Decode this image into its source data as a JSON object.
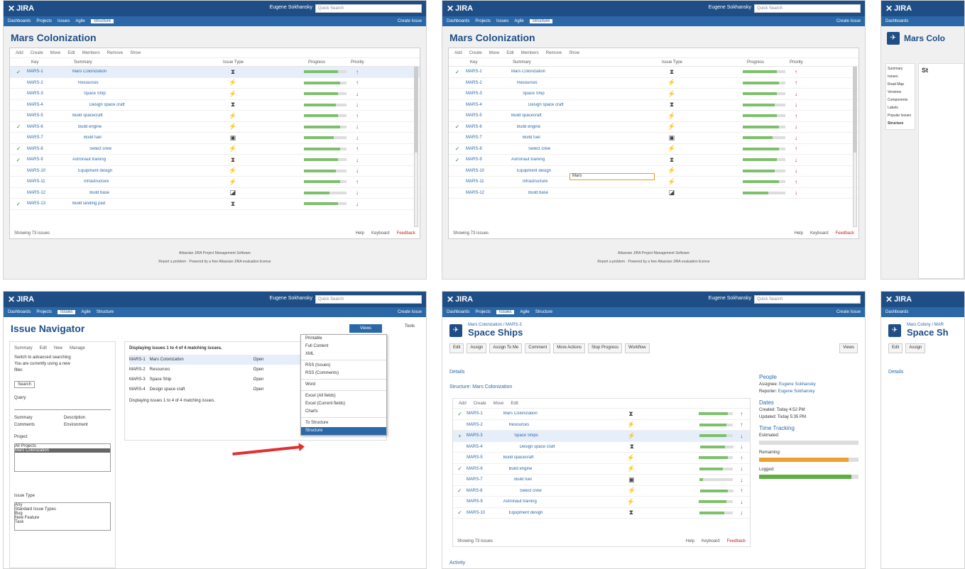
{
  "app": {
    "name": "JIRA",
    "user": "Eugene Sokhansky",
    "quick_search": "Quick Search",
    "nav_items": [
      "Dashboards",
      "Projects",
      "Issues",
      "Agile",
      "Structure"
    ],
    "nav_right": "Create Issue"
  },
  "structure_page": {
    "title": "Mars Colonization",
    "toolbar": [
      "Add",
      "Create",
      "Move",
      "Edit",
      "Members",
      "Remove",
      "Show"
    ],
    "columns": [
      "Key",
      "Summary",
      "Issue Type",
      "Progress",
      "Priority"
    ],
    "rows": [
      {
        "check": "✓",
        "key": "MARS-1",
        "summary": "Mars Colonization",
        "type": "⧗",
        "progress": 0.8,
        "prio": "↑"
      },
      {
        "check": "",
        "key": "MARS-2",
        "summary": "Resources",
        "type": "⚡",
        "progress": 0.85,
        "prio": "↑"
      },
      {
        "check": "",
        "key": "MARS-3",
        "summary": "Space Ship",
        "type": "⚡",
        "progress": 0.8,
        "prio": "↓"
      },
      {
        "check": "",
        "key": "MARS-4",
        "summary": "Design space craft",
        "type": "⧗",
        "progress": 0.75,
        "prio": "↓"
      },
      {
        "check": "",
        "key": "MARS-5",
        "summary": "Build spacecraft",
        "type": "⚡",
        "progress": 0.8,
        "prio": "↑"
      },
      {
        "check": "✓",
        "key": "MARS-6",
        "summary": "Build engine",
        "type": "⚡",
        "progress": 0.85,
        "prio": "↓"
      },
      {
        "check": "",
        "key": "MARS-7",
        "summary": "Build fuel",
        "type": "▣",
        "progress": 0.7,
        "prio": "↓"
      },
      {
        "check": "✓",
        "key": "MARS-8",
        "summary": "Select crew",
        "type": "⚡",
        "progress": 0.85,
        "prio": "↑"
      },
      {
        "check": "✓",
        "key": "MARS-9",
        "summary": "Astronaut training",
        "type": "⧗",
        "progress": 0.8,
        "prio": "↓"
      },
      {
        "check": "",
        "key": "MARS-10",
        "summary": "Equipment design",
        "type": "⚡",
        "progress": 0.75,
        "prio": "↓"
      },
      {
        "check": "",
        "key": "MARS-11",
        "summary": "Infrastructure",
        "type": "⚡",
        "progress": 0.85,
        "prio": "↑"
      },
      {
        "check": "",
        "key": "MARS-12",
        "summary": "Build base",
        "type": "◪",
        "progress": 0.6,
        "prio": "↓"
      },
      {
        "check": "✓",
        "key": "MARS-13",
        "summary": "Build landing pad",
        "type": "⧗",
        "progress": 0.8,
        "prio": "↓"
      }
    ],
    "footer_left": "Showing 73 issues",
    "footer_help": "Help",
    "footer_keyboard": "Keyboard",
    "footer_feedback": "Feedback",
    "footer_line1": "Atlassian JIRA Project Management Software",
    "footer_line2": "Report a problem · Powered by a free Atlassian JIRA evaluation license",
    "editing_value": "Mars"
  },
  "right_partial": {
    "title": "Mars Colo",
    "side_items": [
      "Summary",
      "Issues",
      "Road Map",
      "Versions",
      "Components",
      "Labels",
      "Popular Issues",
      "Structure"
    ],
    "selected_item": "Structure",
    "main_heading": "St"
  },
  "issue_nav": {
    "title": "Issue Navigator",
    "views": "Views",
    "tools": "Tools",
    "tabs": [
      "Summary",
      "Edit",
      "New",
      "Manage"
    ],
    "intro": "Switch to advanced searching",
    "info1": "You are currently using a new",
    "info2": "filter.",
    "search_btn": "Search",
    "query_label": "Query",
    "checks": [
      "Summary",
      "Description",
      "Comments",
      "Environment"
    ],
    "project_label": "Project",
    "projects": [
      "All Projects",
      "Mars Colonization"
    ],
    "type_label": "Issue Type",
    "types": [
      "Any",
      "Standard Issue Types",
      "Bug",
      "New Feature",
      "Task"
    ],
    "results_header": "Displaying issues 1 to 4 of 4 matching issues.",
    "results": [
      {
        "key": "MARS-1",
        "summary": "Mars Colonization",
        "status": "Open"
      },
      {
        "key": "MARS-2",
        "summary": "Resources",
        "status": "Open"
      },
      {
        "key": "MARS-3",
        "summary": "Space Ship",
        "status": "Open"
      },
      {
        "key": "MARS-4",
        "summary": "Design space craft",
        "status": "Open"
      }
    ],
    "results_footer": "Displaying issues 1 to 4 of 4 matching issues.",
    "menu": [
      "Printable",
      "Full Content",
      "XML",
      "RSS (Issues)",
      "RSS (Comments)",
      "Word",
      "Excel (All fields)",
      "Excel (Current fields)",
      "Charts",
      "To Structure",
      "Structure"
    ],
    "menu_highlighted": "Structure"
  },
  "space_ships": {
    "crumb": "Mars Colonization / MARS-3",
    "title": "Space Ships",
    "actions": [
      "Edit",
      "Assign",
      "Assign To Me",
      "Comment",
      "More Actions",
      "Stop Progress",
      "Workflow"
    ],
    "views": "Views",
    "details": "Details",
    "structure": "Structure: Mars Colonization",
    "people": "People",
    "assignee_label": "Assignee:",
    "assignee": "Eugene Sokhansky",
    "reporter_label": "Reporter:",
    "reporter": "Eugene Sokhansky",
    "dates": "Dates",
    "created_label": "Created:",
    "created": "Today 4:52 PM",
    "updated_label": "Updated:",
    "updated": "Today 5:35 PM",
    "time": "Time Tracking",
    "estimated_label": "Estimated:",
    "remaining_label": "Remaining:",
    "logged_label": "Logged:",
    "estimated_progress": 0.0,
    "remaining_progress": 0.9,
    "logged_progress": 0.93,
    "activity": "Activity",
    "rows": [
      {
        "check": "✓",
        "key": "MARS-1",
        "summary": "Mars Colonization",
        "progress": 0.85,
        "type": "⧗",
        "prio": "↑"
      },
      {
        "check": "",
        "key": "MARS-2",
        "summary": "Resources",
        "progress": 0.8,
        "type": "⚡",
        "prio": "↑"
      },
      {
        "check": "+",
        "key": "MARS-3",
        "summary": "Space Ships",
        "progress": 0.8,
        "type": "⚡",
        "prio": "↓"
      },
      {
        "check": "",
        "key": "MARS-4",
        "summary": "Design space craft",
        "progress": 0.75,
        "type": "⧗",
        "prio": "↓"
      },
      {
        "check": "",
        "key": "MARS-5",
        "summary": "Build spacecraft",
        "progress": 0.85,
        "type": "⚡",
        "prio": "↑"
      },
      {
        "check": "✓",
        "key": "MARS-6",
        "summary": "Build engine",
        "progress": 0.7,
        "type": "⚡",
        "prio": "↓"
      },
      {
        "check": "",
        "key": "MARS-7",
        "summary": "Build fuel",
        "progress": 0.1,
        "type": "▣",
        "prio": "↓"
      },
      {
        "check": "✓",
        "key": "MARS-8",
        "summary": "Select crew",
        "progress": 0.85,
        "type": "⚡",
        "prio": "↑"
      },
      {
        "check": "",
        "key": "MARS-9",
        "summary": "Astronaut training",
        "progress": 0.8,
        "type": "⚡",
        "prio": "↓"
      },
      {
        "check": "✓",
        "key": "MARS-10",
        "summary": "Equipment design",
        "progress": 0.75,
        "type": "⧗",
        "prio": "↓"
      }
    ]
  },
  "br_partial": {
    "title": "Space Sh",
    "crumb": "Mars Colony / MAR"
  },
  "colors": {
    "topbar": "#1f4e86",
    "navbar": "#2b68a8",
    "progress": "#7cc06b",
    "priority": "#c02020",
    "remaining": "#f0a030",
    "logged": "#5cb040"
  }
}
